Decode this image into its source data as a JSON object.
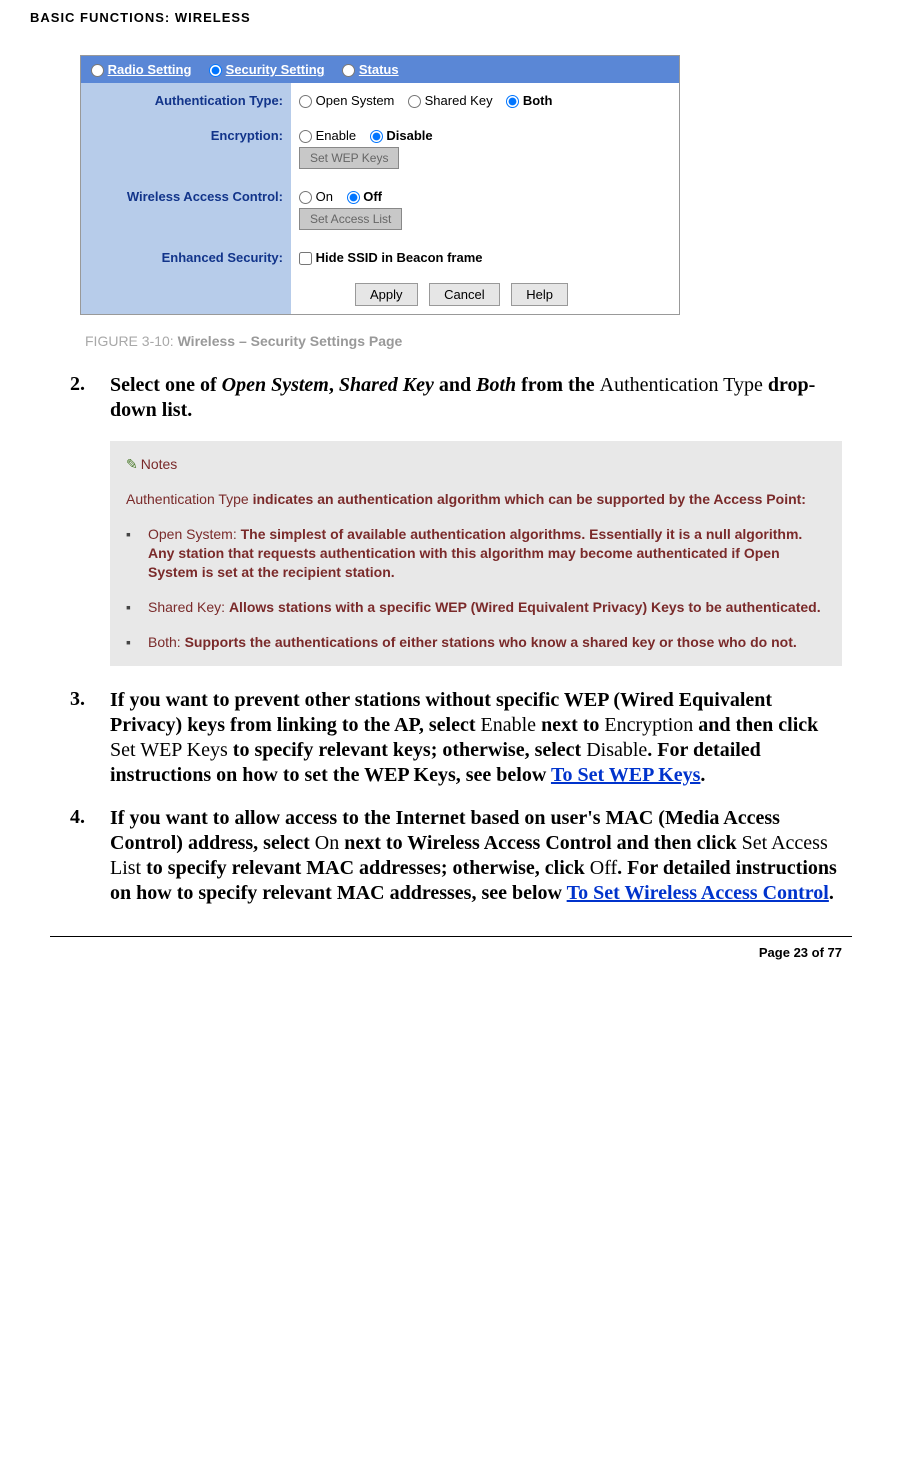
{
  "header": {
    "section": "BASIC FUNCTIONS: WIRELESS"
  },
  "screenshot": {
    "tabs": {
      "radio": "Radio Setting",
      "security": "Security Setting",
      "status": "Status"
    },
    "rows": {
      "auth_label": "Authentication Type:",
      "auth_open": "Open System",
      "auth_shared": "Shared Key",
      "auth_both": "Both",
      "enc_label": "Encryption:",
      "enc_enable": "Enable",
      "enc_disable": "Disable",
      "enc_btn": "Set WEP Keys",
      "wac_label": "Wireless Access Control:",
      "wac_on": "On",
      "wac_off": "Off",
      "wac_btn": "Set Access List",
      "es_label": "Enhanced Security:",
      "es_hide": "Hide SSID in Beacon frame"
    },
    "buttons": {
      "apply": "Apply",
      "cancel": "Cancel",
      "help": "Help"
    }
  },
  "figure": {
    "lead": "FIGURE 3-10: ",
    "title": "Wireless – Security Settings Page"
  },
  "step2": {
    "num": "2.",
    "p1": "Select one of ",
    "open": "Open System",
    "comma": ", ",
    "shared": "Shared Key",
    "and": " and ",
    "both": "Both",
    "p2": " from the ",
    "auth": "Authentication Type ",
    "dd": "drop-down list."
  },
  "notes": {
    "title": "Notes",
    "lead_light": "Authentication Type ",
    "lead_bold": "indicates an authentication algorithm which can be supported by the Access Point:",
    "i1_light": "Open System: ",
    "i1_bold": "The simplest of available authentication algorithms. Essentially it is a null algorithm. Any station that requests authentication with this algorithm may become authenticated if Open System is set at the recipient station.",
    "i2_light": "Shared Key: ",
    "i2_bold": "Allows stations with a specific WEP (Wired Equivalent Privacy) Keys to be authenticated.",
    "i3_light": "Both: ",
    "i3_bold": "Supports the authentications of either stations who know a shared key or those who do not."
  },
  "step3": {
    "num": "3.",
    "t1": "If you want to prevent other stations without specific WEP (Wired Equivalent Privacy) keys from linking to the AP, select ",
    "enable": "Enable",
    "t2": " next to ",
    "enc": "Encryption",
    "t3": " and then click ",
    "swk": "Set WEP Keys",
    "t4": " to specify relevant keys; otherwise, select ",
    "disable": "Disable",
    "t5": ". For detailed instructions on how to set the WEP Keys, see below ",
    "link": "To Set WEP Keys",
    "t6": "."
  },
  "step4": {
    "num": "4.",
    "t1": "If you want to allow access to the Internet based on user's MAC (Media Access Control) address, select ",
    "on": "On",
    "t2": " next to Wireless Access Control and then click ",
    "sal": "Set Access List",
    "t3": " to specify relevant MAC addresses; otherwise, click ",
    "off": "Off",
    "t4": ". For detailed instructions on how to specify relevant MAC addresses, see below ",
    "link": "To Set Wireless Access Control",
    "t5": "."
  },
  "footer": {
    "page": "Page 23 of 77"
  }
}
